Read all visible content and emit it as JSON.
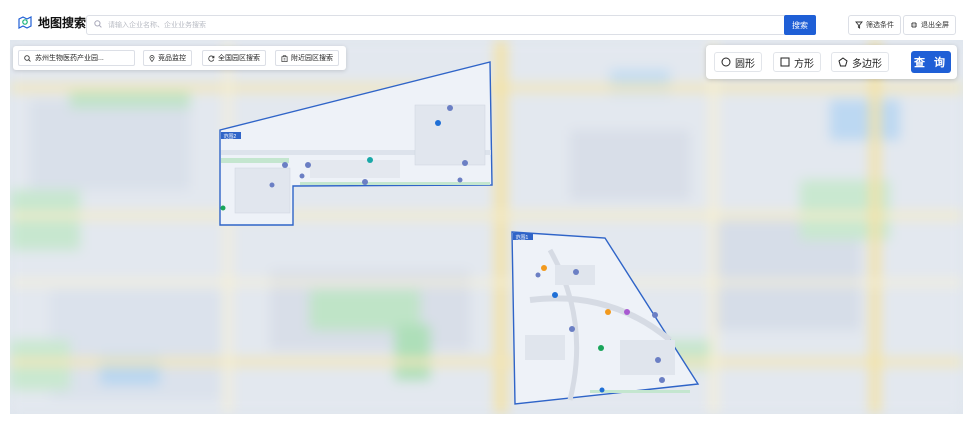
{
  "header": {
    "title": "地图搜索",
    "search_placeholder": "请输入企业名称、企业业务搜索",
    "search_button": "搜索",
    "filter_button": "筛选条件",
    "exit_fullscreen_button": "退出全屏"
  },
  "map_toolbar": {
    "park_select": "苏州生物医药产业园...",
    "buttons": {
      "monitor": "竞品监控",
      "national": "全国园区搜索",
      "nearby": "附近园区搜索"
    }
  },
  "shape_toolbar": {
    "circle": "圆形",
    "square": "方形",
    "polygon": "多边形",
    "query": "查 询"
  },
  "regions": {
    "region1": "范围1",
    "region2": "范围2"
  },
  "colors": {
    "accent": "#1f5fd6",
    "region_fill": "#e9eef7",
    "region_border": "#3b6fd0"
  }
}
